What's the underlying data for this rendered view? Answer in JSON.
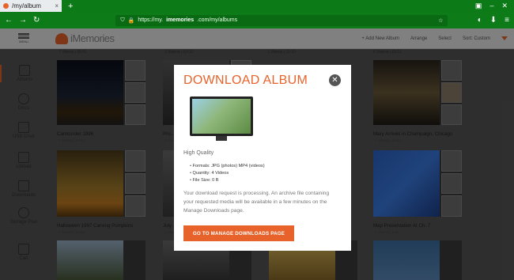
{
  "browser": {
    "tab_title": "/my/album",
    "tab_close": "×",
    "new_tab": "+",
    "url_prefix": "https://my.",
    "url_domain": "imemories",
    "url_rest": ".com/my/albums"
  },
  "header": {
    "menu_label": "MENU",
    "logo_text": "iMemories",
    "actions": [
      "+ Add New Album",
      "Arrange",
      "Select",
      "Sort: Custom"
    ]
  },
  "sidebar": {
    "items": [
      "Albums",
      "Discs",
      "USB Drive",
      "Upload",
      "Downloads",
      "Storage Plan",
      "Cart"
    ]
  },
  "grid": {
    "top_meta": [
      "7 Videos | 55:51",
      "3 Videos | 53:02",
      "1 Videos | 12:13",
      "6 Videos | 55:11"
    ],
    "rows": [
      [
        {
          "title": "Camcorder 1996",
          "sub": "7 Videos | 55:30"
        },
        {
          "title": "Pro...",
          "sub": "1 Videos | 25:..."
        },
        {
          "title": "",
          "sub": ""
        },
        {
          "title": "Mary Arrives in Champaign, Chicago",
          "sub": "7 Videos | 23:43"
        }
      ],
      [
        {
          "title": "Halloween 1997 Carving Pumpkins",
          "sub": "7 Videos | 55:30"
        },
        {
          "title": "July...",
          "sub": "1 Videos"
        },
        {
          "title": "",
          "sub": ""
        },
        {
          "title": "Map Presentation At Ch. 7",
          "sub": "1 Videos | 1:42"
        }
      ]
    ]
  },
  "modal": {
    "title": "DOWNLOAD ALBUM",
    "close": "✕",
    "quality": "High Quality",
    "specs": [
      "Formats: JPG (photos) MP4 (videos)",
      "Quantity: 4 Videos",
      "File Size: 0 B"
    ],
    "description": "Your download request is processing. An archive file containing your requested media will be available in a few minutes on the Manage Downloads page.",
    "cta": "GO TO MANAGE DOWNLOADS PAGE"
  },
  "colors": {
    "accent": "#e8632b",
    "browser_green": "#0c7b18"
  }
}
